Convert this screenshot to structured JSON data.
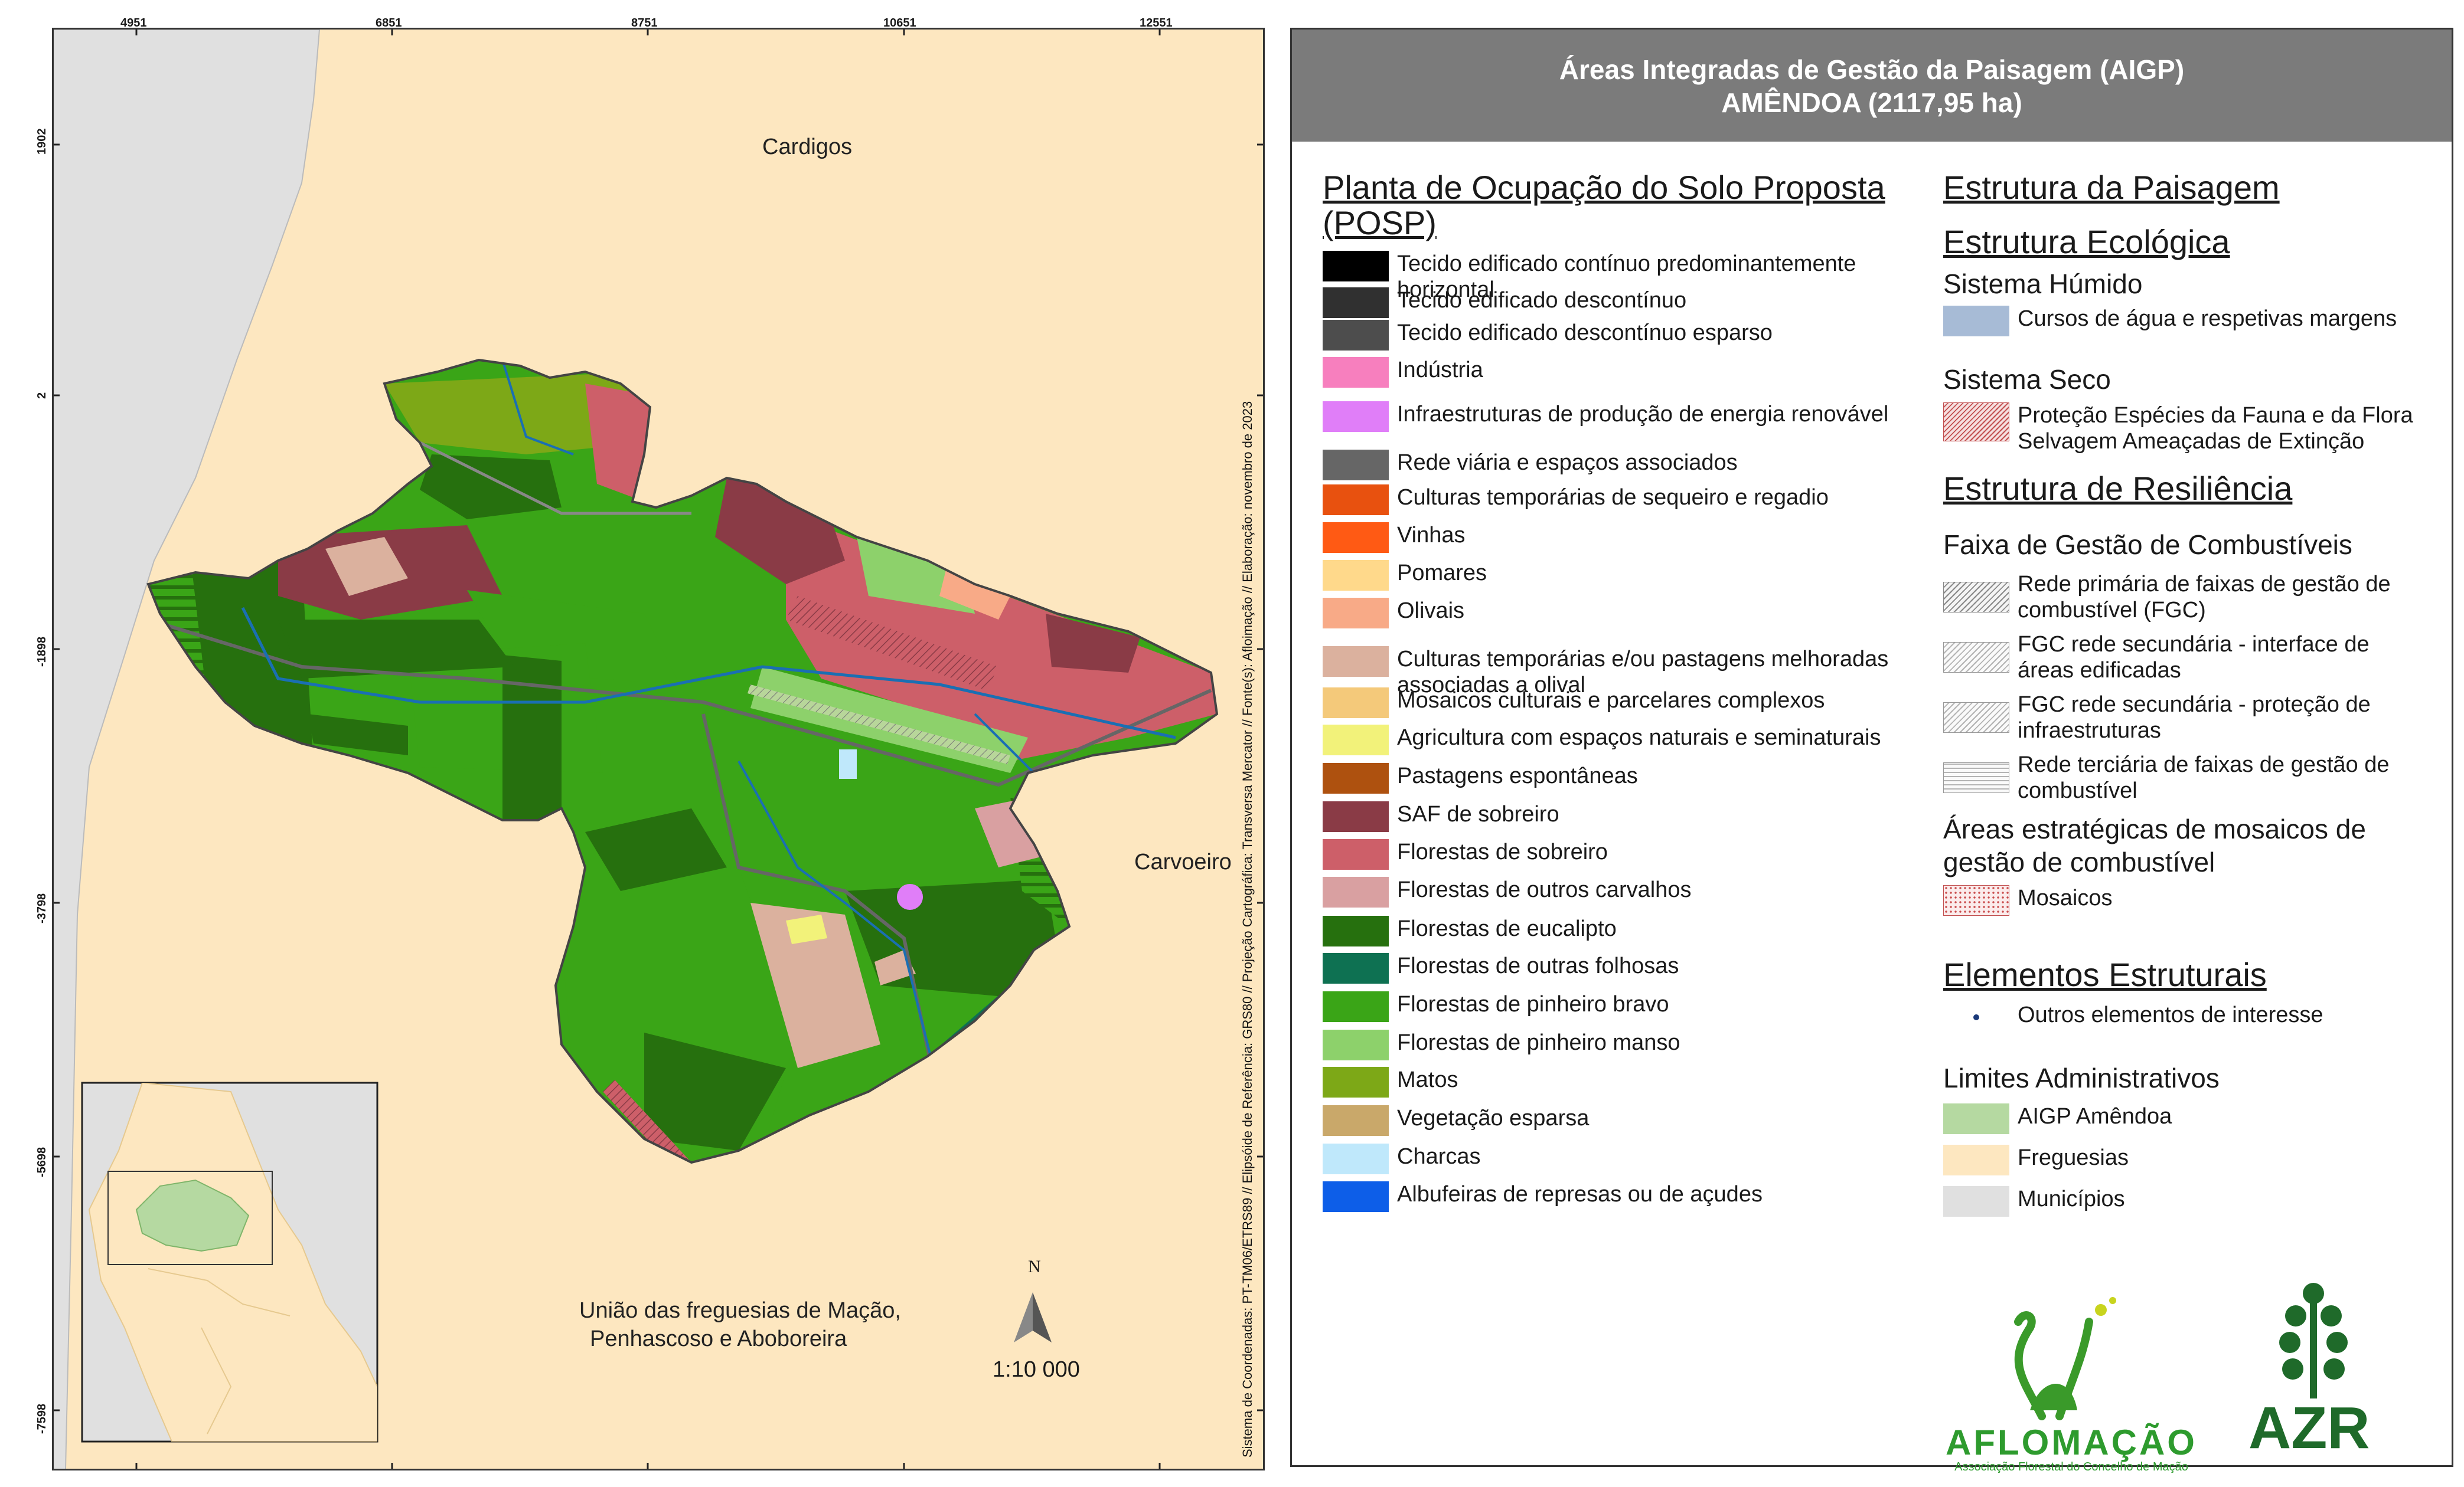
{
  "map": {
    "grid_top": [
      "4951",
      "6851",
      "8751",
      "10651",
      "12551"
    ],
    "grid_left": [
      "1902",
      "2",
      "-1898",
      "-3798",
      "-5698",
      "-7598"
    ],
    "places": {
      "north": "Cardigos",
      "east": "Carvoeiro",
      "south_line1": "União das freguesias de Mação,",
      "south_line2": "Penhascoso e Aboboreira"
    },
    "north_arrow": "N",
    "scale": "1:10 000",
    "side_note": "Sistema de Coordenadas: PT-TM06/ETRS89 // Elipsóide de Referência: GRS80 // Projeção Cartográfica: Transversa Mercator // Fonte(s): Afloimação // Elaboração: novembro de 2023"
  },
  "legend": {
    "header_line1": "Áreas Integradas de Gestão da Paisagem (AIGP)",
    "header_line2": "AMÊNDOA (2117,95 ha)",
    "posp_title": "Planta de Ocupação do Solo Proposta (POSP)",
    "posp_items": [
      {
        "label": "Tecido edificado contínuo predominantemente horizontal",
        "color": "#000000"
      },
      {
        "label": "Tecido edificado descontínuo",
        "color": "#303030"
      },
      {
        "label": "Tecido edificado descontínuo esparso",
        "color": "#4d4d4d"
      },
      {
        "label": "Indústria",
        "color": "#f77fbe"
      },
      {
        "label": "Infraestruturas de produção de energia renovável",
        "color": "#e07ef8"
      },
      {
        "label": "Rede viária e espaços associados",
        "color": "#666666"
      },
      {
        "label": "Culturas temporárias de sequeiro e regadio",
        "color": "#e8510f"
      },
      {
        "label": "Vinhas",
        "color": "#ff5a14"
      },
      {
        "label": "Pomares",
        "color": "#ffd98b"
      },
      {
        "label": "Olivais",
        "color": "#f8aa87"
      },
      {
        "label": "Culturas temporárias e/ou pastagens melhoradas associadas a olival",
        "color": "#dbb19e"
      },
      {
        "label": "Mosaicos culturais e parcelares complexos",
        "color": "#f4c97a"
      },
      {
        "label": "Agricultura com espaços naturais e seminaturais",
        "color": "#f2f27a"
      },
      {
        "label": "Pastagens espontâneas",
        "color": "#ae510f"
      },
      {
        "label": "SAF de sobreiro",
        "color": "#8a3b46"
      },
      {
        "label": "Florestas de sobreiro",
        "color": "#cd5f69"
      },
      {
        "label": "Florestas de outros carvalhos",
        "color": "#d9a0a1"
      },
      {
        "label": "Florestas de eucalipto",
        "color": "#26700e"
      },
      {
        "label": "Florestas de outras folhosas",
        "color": "#0e7152"
      },
      {
        "label": "Florestas de pinheiro bravo",
        "color": "#3aa517"
      },
      {
        "label": "Florestas de pinheiro manso",
        "color": "#8dd16b"
      },
      {
        "label": "Matos",
        "color": "#7da817"
      },
      {
        "label": "Vegetação esparsa",
        "color": "#c9a86a"
      },
      {
        "label": "Charcas",
        "color": "#bfe8fb"
      },
      {
        "label": "Albufeiras de represas ou de açudes",
        "color": "#0d5ee8"
      }
    ],
    "estrutura_paisagem": "Estrutura da Paisagem",
    "estrutura_ecologica": "Estrutura Ecológica",
    "sistema_humido": "Sistema Húmido",
    "cursos_agua": "Cursos de água e respetivas margens",
    "cursos_agua_color": "#a7bbd6",
    "sistema_seco": "Sistema Seco",
    "protecao_line1": "Proteção Espécies da Fauna e da Flora",
    "protecao_line2": "Selvagem Ameaçadas de Extinção",
    "estrutura_resiliencia": "Estrutura de Resiliência",
    "faixa_gestao": "Faixa de Gestão de Combustíveis",
    "fgc_items": [
      {
        "line1": "Rede primária de faixas de gestão de",
        "line2": "combustível (FGC)",
        "pattern": "gray"
      },
      {
        "line1": "FGC rede secundária - interface de",
        "line2": "áreas edificadas",
        "pattern": "light"
      },
      {
        "line1": "FGC rede secundária - proteção de",
        "line2": "infraestruturas",
        "pattern": "light"
      },
      {
        "line1": "Rede terciária de faixas de gestão de",
        "line2": "combustível",
        "pattern": "horiz"
      }
    ],
    "mosaicos_title_line1": "Áreas estratégicas de mosaicos de",
    "mosaicos_title_line2": "gestão de combustível",
    "mosaicos": "Mosaicos",
    "elementos_estruturais": "Elementos Estruturais",
    "outros_elementos": "Outros elementos de interesse",
    "limites": "Limites Administrativos",
    "limites_items": [
      {
        "label": "AIGP Amêndoa",
        "color": "#b5d9a1"
      },
      {
        "label": "Freguesias",
        "color": "#fde7c0"
      },
      {
        "label": "Municípios",
        "color": "#e0e0e0"
      }
    ],
    "logo1_text": "AFLOMAÇÃO",
    "logo1_sub": "Associação Florestal do Concelho de Mação",
    "logo2_text": "AZR"
  }
}
